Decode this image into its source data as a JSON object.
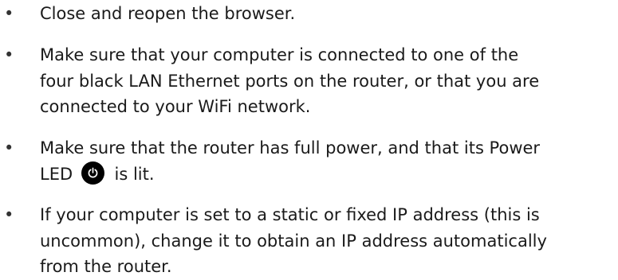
{
  "bullets": [
    {
      "symbol": "•",
      "text": "Close and reopen the browser."
    },
    {
      "symbol": "•",
      "text_line1": "Make sure that your computer is connected to one of the",
      "text_line2": "four black LAN Ethernet ports on the router, or that you are",
      "text_line3": "connected to your WiFi network."
    },
    {
      "symbol": "•",
      "text_line1": "Make sure that the router has full power, and that its Power",
      "text_before_icon": "LED",
      "icon": "power-icon",
      "text_after_icon": "is lit."
    },
    {
      "symbol": "•",
      "text_line1": "If your computer is set to a static or fixed IP address (this is",
      "text_line2": "uncommon), change it to obtain an IP address automatically",
      "text_line3": "from the router."
    }
  ],
  "colors": {
    "text": "#1a1a1a",
    "icon_background": "#000000",
    "icon_symbol": "#ffffff"
  }
}
